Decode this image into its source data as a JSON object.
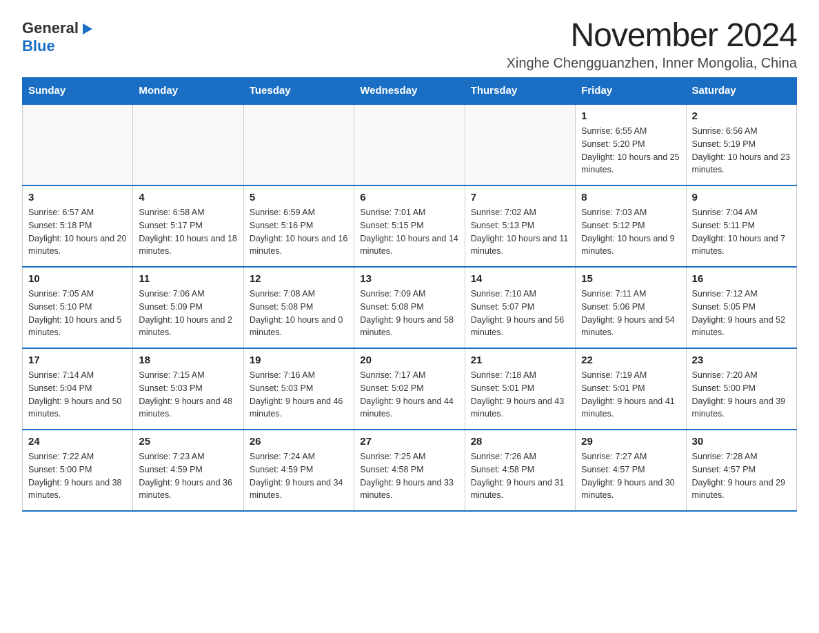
{
  "logo": {
    "general": "General",
    "blue": "Blue",
    "arrow": "▶"
  },
  "title": "November 2024",
  "subtitle": "Xinghe Chengguanzhen, Inner Mongolia, China",
  "weekdays": [
    "Sunday",
    "Monday",
    "Tuesday",
    "Wednesday",
    "Thursday",
    "Friday",
    "Saturday"
  ],
  "weeks": [
    [
      {
        "day": "",
        "info": ""
      },
      {
        "day": "",
        "info": ""
      },
      {
        "day": "",
        "info": ""
      },
      {
        "day": "",
        "info": ""
      },
      {
        "day": "",
        "info": ""
      },
      {
        "day": "1",
        "info": "Sunrise: 6:55 AM\nSunset: 5:20 PM\nDaylight: 10 hours and 25 minutes."
      },
      {
        "day": "2",
        "info": "Sunrise: 6:56 AM\nSunset: 5:19 PM\nDaylight: 10 hours and 23 minutes."
      }
    ],
    [
      {
        "day": "3",
        "info": "Sunrise: 6:57 AM\nSunset: 5:18 PM\nDaylight: 10 hours and 20 minutes."
      },
      {
        "day": "4",
        "info": "Sunrise: 6:58 AM\nSunset: 5:17 PM\nDaylight: 10 hours and 18 minutes."
      },
      {
        "day": "5",
        "info": "Sunrise: 6:59 AM\nSunset: 5:16 PM\nDaylight: 10 hours and 16 minutes."
      },
      {
        "day": "6",
        "info": "Sunrise: 7:01 AM\nSunset: 5:15 PM\nDaylight: 10 hours and 14 minutes."
      },
      {
        "day": "7",
        "info": "Sunrise: 7:02 AM\nSunset: 5:13 PM\nDaylight: 10 hours and 11 minutes."
      },
      {
        "day": "8",
        "info": "Sunrise: 7:03 AM\nSunset: 5:12 PM\nDaylight: 10 hours and 9 minutes."
      },
      {
        "day": "9",
        "info": "Sunrise: 7:04 AM\nSunset: 5:11 PM\nDaylight: 10 hours and 7 minutes."
      }
    ],
    [
      {
        "day": "10",
        "info": "Sunrise: 7:05 AM\nSunset: 5:10 PM\nDaylight: 10 hours and 5 minutes."
      },
      {
        "day": "11",
        "info": "Sunrise: 7:06 AM\nSunset: 5:09 PM\nDaylight: 10 hours and 2 minutes."
      },
      {
        "day": "12",
        "info": "Sunrise: 7:08 AM\nSunset: 5:08 PM\nDaylight: 10 hours and 0 minutes."
      },
      {
        "day": "13",
        "info": "Sunrise: 7:09 AM\nSunset: 5:08 PM\nDaylight: 9 hours and 58 minutes."
      },
      {
        "day": "14",
        "info": "Sunrise: 7:10 AM\nSunset: 5:07 PM\nDaylight: 9 hours and 56 minutes."
      },
      {
        "day": "15",
        "info": "Sunrise: 7:11 AM\nSunset: 5:06 PM\nDaylight: 9 hours and 54 minutes."
      },
      {
        "day": "16",
        "info": "Sunrise: 7:12 AM\nSunset: 5:05 PM\nDaylight: 9 hours and 52 minutes."
      }
    ],
    [
      {
        "day": "17",
        "info": "Sunrise: 7:14 AM\nSunset: 5:04 PM\nDaylight: 9 hours and 50 minutes."
      },
      {
        "day": "18",
        "info": "Sunrise: 7:15 AM\nSunset: 5:03 PM\nDaylight: 9 hours and 48 minutes."
      },
      {
        "day": "19",
        "info": "Sunrise: 7:16 AM\nSunset: 5:03 PM\nDaylight: 9 hours and 46 minutes."
      },
      {
        "day": "20",
        "info": "Sunrise: 7:17 AM\nSunset: 5:02 PM\nDaylight: 9 hours and 44 minutes."
      },
      {
        "day": "21",
        "info": "Sunrise: 7:18 AM\nSunset: 5:01 PM\nDaylight: 9 hours and 43 minutes."
      },
      {
        "day": "22",
        "info": "Sunrise: 7:19 AM\nSunset: 5:01 PM\nDaylight: 9 hours and 41 minutes."
      },
      {
        "day": "23",
        "info": "Sunrise: 7:20 AM\nSunset: 5:00 PM\nDaylight: 9 hours and 39 minutes."
      }
    ],
    [
      {
        "day": "24",
        "info": "Sunrise: 7:22 AM\nSunset: 5:00 PM\nDaylight: 9 hours and 38 minutes."
      },
      {
        "day": "25",
        "info": "Sunrise: 7:23 AM\nSunset: 4:59 PM\nDaylight: 9 hours and 36 minutes."
      },
      {
        "day": "26",
        "info": "Sunrise: 7:24 AM\nSunset: 4:59 PM\nDaylight: 9 hours and 34 minutes."
      },
      {
        "day": "27",
        "info": "Sunrise: 7:25 AM\nSunset: 4:58 PM\nDaylight: 9 hours and 33 minutes."
      },
      {
        "day": "28",
        "info": "Sunrise: 7:26 AM\nSunset: 4:58 PM\nDaylight: 9 hours and 31 minutes."
      },
      {
        "day": "29",
        "info": "Sunrise: 7:27 AM\nSunset: 4:57 PM\nDaylight: 9 hours and 30 minutes."
      },
      {
        "day": "30",
        "info": "Sunrise: 7:28 AM\nSunset: 4:57 PM\nDaylight: 9 hours and 29 minutes."
      }
    ]
  ]
}
